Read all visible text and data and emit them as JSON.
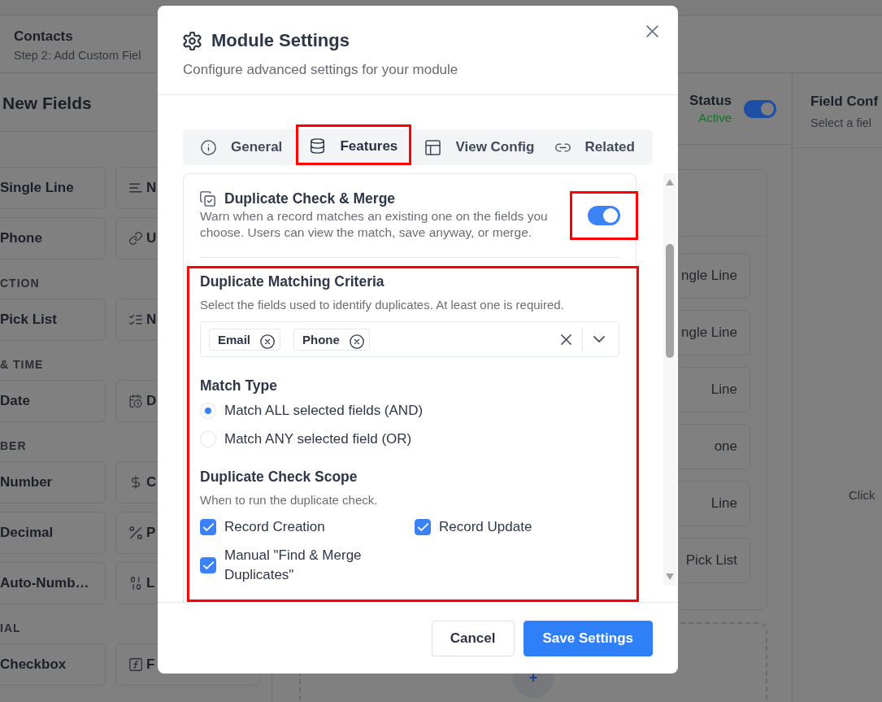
{
  "page_header": {
    "title": "Contacts",
    "subtitle": "Step 2: Add Custom Fiel"
  },
  "fields_panel": {
    "title": "New Fields",
    "groups": [
      {
        "items": [
          {
            "label": "Single Line"
          },
          {
            "label": "N",
            "kind": "lines"
          },
          {
            "label": "Phone"
          },
          {
            "label": "U",
            "kind": "link"
          }
        ]
      },
      {
        "label": "CTION",
        "items": [
          {
            "label": "Pick List"
          },
          {
            "label": "N",
            "kind": "checklist"
          }
        ]
      },
      {
        "label": "& TIME",
        "items": [
          {
            "label": "Date"
          },
          {
            "label": "D",
            "kind": "calendar"
          }
        ]
      },
      {
        "label": "BER",
        "items": [
          {
            "label": "Number"
          },
          {
            "label": "C",
            "kind": "dollar"
          },
          {
            "label": "Decimal"
          },
          {
            "label": "P",
            "kind": "percent"
          },
          {
            "label": "Auto-Numb…"
          },
          {
            "label": "L",
            "kind": "digits"
          }
        ]
      },
      {
        "label": "IAL",
        "items": [
          {
            "label": "Checkbox"
          },
          {
            "label": "F",
            "kind": "function"
          }
        ]
      }
    ]
  },
  "layout_panel": {
    "status": {
      "label": "Status",
      "value": "Active",
      "on": true
    },
    "fields": [
      "ngle Line",
      "ngle Line",
      "Line",
      "one",
      "Line",
      "Pick List"
    ],
    "add_label": "+"
  },
  "config_panel": {
    "title": "Field Conf",
    "subtitle": "Select a fiel",
    "hint": "Click"
  },
  "modal": {
    "title": "Module Settings",
    "subtitle": "Configure advanced settings for your module",
    "tabs": [
      {
        "label": "General",
        "kind": "info",
        "selected": false,
        "highlighted": false
      },
      {
        "label": "Features",
        "kind": "database",
        "selected": true,
        "highlighted": true
      },
      {
        "label": "View Config",
        "kind": "layout",
        "selected": false,
        "highlighted": false
      },
      {
        "label": "Related",
        "kind": "link",
        "selected": false,
        "highlighted": false
      }
    ],
    "feature": {
      "title": "Duplicate Check & Merge",
      "description": "Warn when a record matches an existing one on the fields you choose. Users can view the match, save anyway, or merge.",
      "on": true,
      "toggle_highlighted": true
    },
    "settings": {
      "highlighted": true,
      "criteria": {
        "title": "Duplicate Matching Criteria",
        "help": "Select the fields used to identify duplicates. At least one is required.",
        "chips": [
          "Email",
          "Phone"
        ]
      },
      "match_type": {
        "title": "Match Type",
        "options": [
          {
            "label": "Match ALL selected fields (AND)",
            "selected": true
          },
          {
            "label": "Match ANY selected field (OR)",
            "selected": false
          }
        ]
      },
      "scope": {
        "title": "Duplicate Check Scope",
        "help": "When to run the duplicate check.",
        "options": [
          {
            "label": "Record Creation",
            "checked": true
          },
          {
            "label": "Record Update",
            "checked": true
          },
          {
            "label": "Manual \"Find & Merge Duplicates\"",
            "checked": true
          }
        ]
      }
    },
    "buttons": [
      {
        "label": "Cancel",
        "kind": "secondary"
      },
      {
        "label": "Save Settings",
        "kind": "primary"
      }
    ]
  }
}
